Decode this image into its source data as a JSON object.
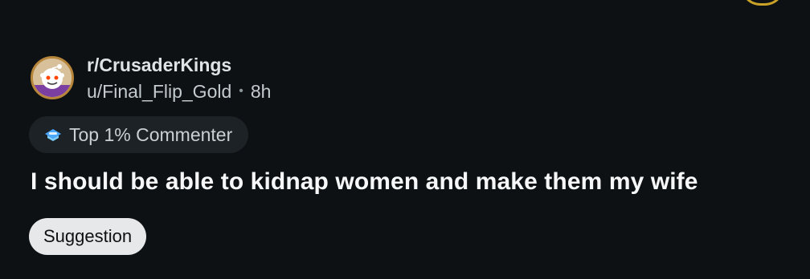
{
  "post": {
    "subreddit": "r/CrusaderKings",
    "author": "u/Final_Flip_Gold",
    "separator": "•",
    "age": "8h",
    "author_flair": "Top 1% Commenter",
    "title": "I should be able to kidnap women and make them my wife",
    "tag": "Suggestion"
  },
  "colors": {
    "background": "#0e1113",
    "flair_bg": "#1d2226",
    "tag_bg": "#e6e8ea",
    "gold_accent": "#c9a227"
  },
  "icons": {
    "avatar": "subreddit-avatar-icon",
    "flair": "top-commenter-icon",
    "corner": "user-avatar-icon"
  }
}
